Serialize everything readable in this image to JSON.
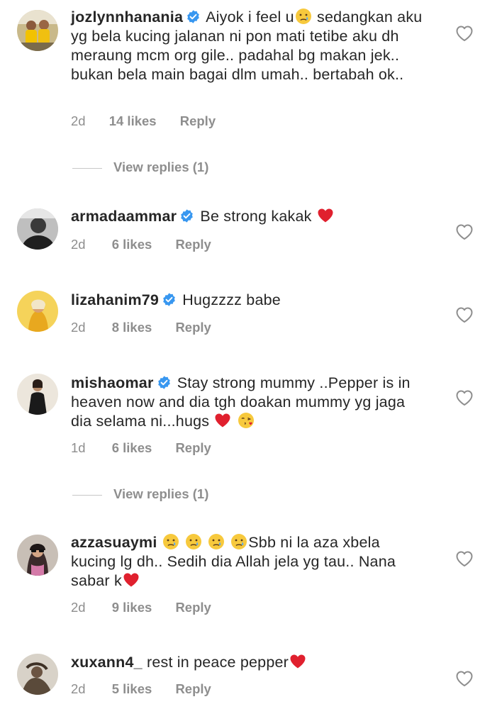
{
  "colors": {
    "text": "#262626",
    "meta": "#8e8e8e",
    "verified_blue": "#3897f0",
    "heart_red": "#ed4956"
  },
  "comments": [
    {
      "username": "jozlynnhanania",
      "verified": true,
      "text_parts": [
        "Aiyok i feel u",
        "sedangkan aku yg bela kucing jalanan ni pon mati tetibe aku dh meraung mcm org gile.. padahal bg makan jek.. bukan bela main bagai dlm umah.. bertabah ok.."
      ],
      "time": "2d",
      "likes": "14 likes",
      "reply": "Reply",
      "view_replies": "View replies (1)"
    },
    {
      "username": "armadaammar",
      "verified": true,
      "text_parts": [
        "Be strong kakak "
      ],
      "time": "2d",
      "likes": "6 likes",
      "reply": "Reply"
    },
    {
      "username": "lizahanim79",
      "verified": true,
      "text_parts": [
        "Hugzzzz babe"
      ],
      "time": "2d",
      "likes": "8 likes",
      "reply": "Reply"
    },
    {
      "username": "mishaomar",
      "verified": true,
      "text_parts": [
        "Stay strong mummy ..Pepper is in heaven now and dia tgh doakan mummy yg jaga dia selama ni...hugs "
      ],
      "time": "1d",
      "likes": "6 likes",
      "reply": "Reply",
      "view_replies": "View replies (1)"
    },
    {
      "username": "azzasuaymi",
      "verified": false,
      "text_parts": [
        "Sbb ni la aza xbela kucing lg dh.. Sedih dia Allah jela yg tau.. Nana sabar k"
      ],
      "time": "2d",
      "likes": "9 likes",
      "reply": "Reply"
    },
    {
      "username": "xuxann4_",
      "verified": false,
      "text_parts": [
        "rest in peace pepper"
      ],
      "time": "2d",
      "likes": "5 likes",
      "reply": "Reply"
    }
  ],
  "icons": {
    "like": "heart-outline-icon",
    "verified": "verified-badge-icon"
  }
}
